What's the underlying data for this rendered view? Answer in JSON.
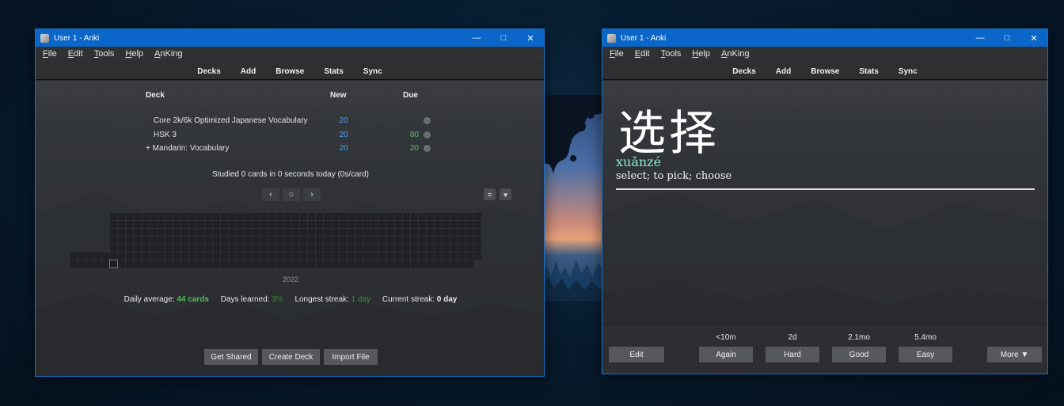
{
  "left_window": {
    "title": "User 1 - Anki",
    "menu": [
      "File",
      "Edit",
      "Tools",
      "Help",
      "AnKing"
    ],
    "toolbar": [
      "Decks",
      "Add",
      "Browse",
      "Stats",
      "Sync"
    ],
    "columns": {
      "deck": "Deck",
      "new": "New",
      "due": "Due"
    },
    "decks": [
      {
        "name": "Core 2k/6k Optimized Japanese Vocabulary",
        "new": "20",
        "learn": "0",
        "due": ""
      },
      {
        "name": "HSK 3",
        "new": "20",
        "learn": "0",
        "due": "80"
      },
      {
        "name": "+ Mandarin: Vocabulary",
        "new": "20",
        "learn": "0",
        "due": "20"
      }
    ],
    "studied": "Studied 0 cards in 0 seconds today (0s/card)",
    "heatmap_year": "2022",
    "stats": {
      "daily_average_label": "Daily average:",
      "daily_average_value": "44 cards",
      "days_learned_label": "Days learned:",
      "days_learned_value": "3%",
      "longest_streak_label": "Longest streak:",
      "longest_streak_value": "1 day",
      "current_streak_label": "Current streak:",
      "current_streak_value": "0 day"
    },
    "buttons": {
      "get_shared": "Get Shared",
      "create_deck": "Create Deck",
      "import_file": "Import File"
    }
  },
  "right_window": {
    "title": "User 1 - Anki",
    "menu": [
      "File",
      "Edit",
      "Tools",
      "Help",
      "AnKing"
    ],
    "toolbar": [
      "Decks",
      "Add",
      "Browse",
      "Stats",
      "Sync"
    ],
    "card": {
      "hanzi": "选择",
      "pinyin": "xuǎnzé",
      "meaning": "select; to pick; choose"
    },
    "intervals": {
      "again": "<10m",
      "hard": "2d",
      "good": "2.1mo",
      "easy": "5.4mo"
    },
    "buttons": {
      "edit": "Edit",
      "again": "Again",
      "hard": "Hard",
      "good": "Good",
      "easy": "Easy",
      "more": "More ▼"
    }
  },
  "colors": {
    "title_bar": "#0a66c8",
    "new_count": "#4da3ff",
    "due_count": "#5ec45e",
    "pinyin": "#8fe8c8"
  }
}
